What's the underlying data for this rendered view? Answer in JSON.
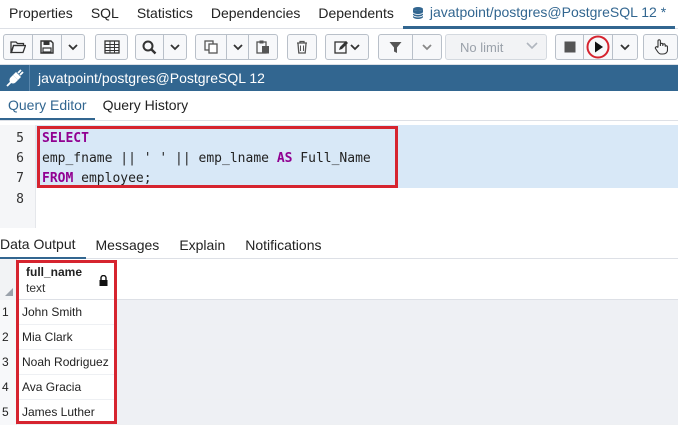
{
  "top_tabs": [
    "Properties",
    "SQL",
    "Statistics",
    "Dependencies",
    "Dependents"
  ],
  "active_tab": "javatpoint/postgres@PostgreSQL 12 *",
  "toolbar": {
    "limit_label": "No limit"
  },
  "connection": {
    "label": "javatpoint/postgres@PostgreSQL 12"
  },
  "editor_tabs": {
    "query_editor": "Query Editor",
    "query_history": "Query History"
  },
  "code": {
    "lines": [
      {
        "num": "5",
        "kw1": "SELECT",
        "text": "",
        "kw2": "",
        "rest": ""
      },
      {
        "num": "6",
        "kw1": "",
        "text": "emp_fname || ' ' || emp_lname ",
        "kw2": "AS",
        "rest": " Full_Name"
      },
      {
        "num": "7",
        "kw1": "FROM",
        "text": " employee;",
        "kw2": "",
        "rest": ""
      },
      {
        "num": "8",
        "kw1": "",
        "text": "",
        "kw2": "",
        "rest": ""
      }
    ]
  },
  "output_tabs": [
    "Data Output",
    "Messages",
    "Explain",
    "Notifications"
  ],
  "grid": {
    "column": {
      "name": "full_name",
      "type": "text"
    },
    "rows": [
      {
        "num": "1",
        "value": "John Smith"
      },
      {
        "num": "2",
        "value": "Mia Clark"
      },
      {
        "num": "3",
        "value": "Noah Rodriguez"
      },
      {
        "num": "4",
        "value": "Ava Gracia"
      },
      {
        "num": "5",
        "value": "James Luther"
      }
    ]
  },
  "colors": {
    "accent": "#326690",
    "highlight_box": "#d6242f",
    "keyword": "#910091"
  }
}
